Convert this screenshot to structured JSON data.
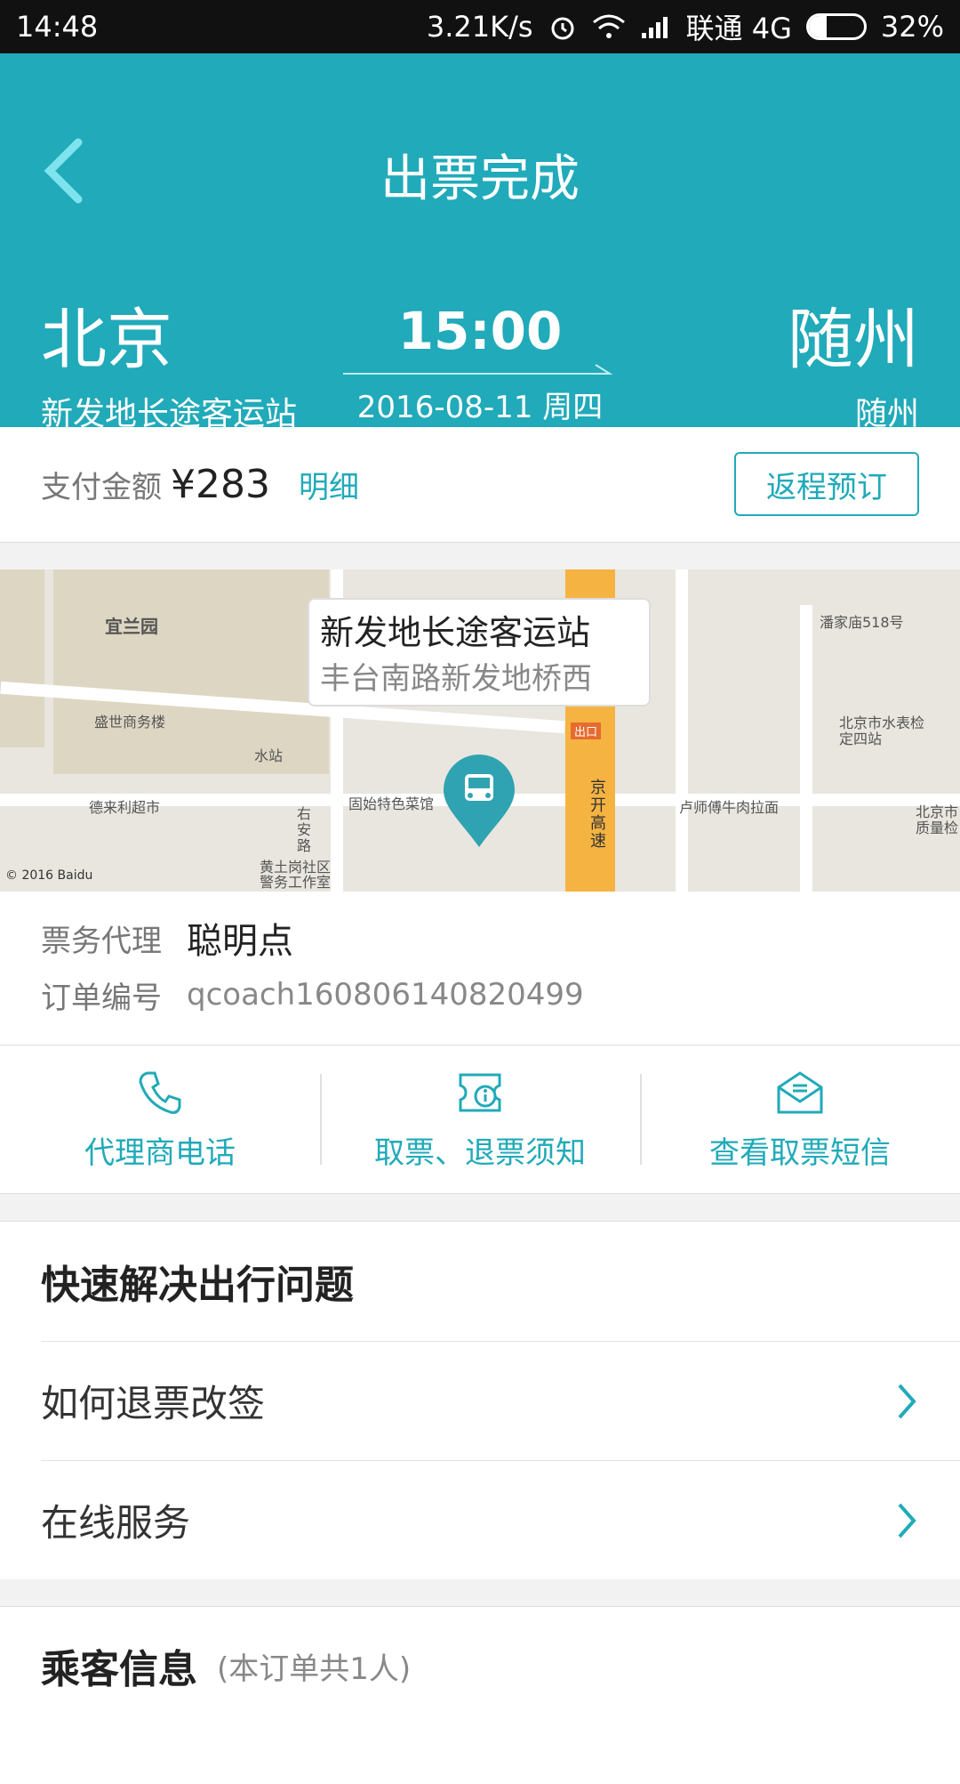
{
  "status_bar": {
    "time": "14:48",
    "speed": "3.21K/s",
    "carrier": "联通 4G",
    "battery": "32%",
    "battery_level": 0.32
  },
  "header": {
    "title": "出票完成",
    "from_city": "北京",
    "from_station": "新发地长途客运站",
    "to_city": "随州",
    "to_station": "随州",
    "time": "15:00",
    "date": "2016-08-11 周四"
  },
  "payment": {
    "label": "支付金额",
    "amount": "¥283",
    "detail_link": "明细",
    "return_button": "返程预订"
  },
  "map": {
    "station_name": "新发地长途客运站",
    "station_address": "丰台南路新发地桥西",
    "labels": [
      "宜兰园",
      "盛世商务楼",
      "水站",
      "德来利超市",
      "固始特色菜馆",
      "黄土岗社区警务工作室",
      "潘家庙518号",
      "北京市水表检定四站",
      "卢师傅牛肉拉面",
      "北京市质量检",
      "京开高速",
      "出口",
      "右安路"
    ],
    "copyright": "© 2016 Baidu"
  },
  "order": {
    "agent_label": "票务代理",
    "agent_value": "聪明点",
    "order_label": "订单编号",
    "order_value": "qcoach160806140820499"
  },
  "actions": [
    {
      "label": "代理商电话",
      "icon": "phone-icon"
    },
    {
      "label": "取票、退票须知",
      "icon": "ticket-info-icon"
    },
    {
      "label": "查看取票短信",
      "icon": "envelope-icon"
    }
  ],
  "quick_help": {
    "title": "快速解决出行问题",
    "items": [
      "如何退票改签",
      "在线服务"
    ]
  },
  "passenger": {
    "title": "乘客信息",
    "subtitle": "(本订单共1人)"
  },
  "colors": {
    "accent": "#21aab9",
    "highway": "#f5b342"
  }
}
